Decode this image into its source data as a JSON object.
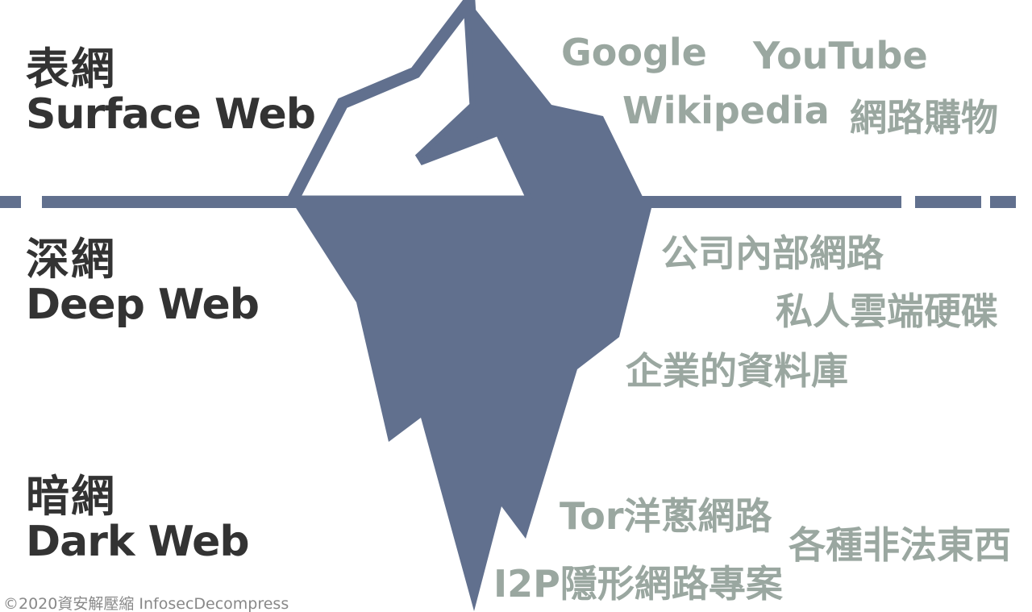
{
  "layers": [
    {
      "zh": "表網",
      "en": "Surface Web"
    },
    {
      "zh": "深網",
      "en": "Deep Web"
    },
    {
      "zh": "暗網",
      "en": "Dark Web"
    }
  ],
  "surface_examples": [
    "Google",
    "YouTube",
    "Wikipedia",
    "網路購物"
  ],
  "deep_examples": [
    "公司內部網路",
    "私人雲端硬碟",
    "企業的資料庫"
  ],
  "dark_examples": [
    "Tor洋蔥網路",
    "各種非法東西",
    "I2P隱形網路專案"
  ],
  "credit": "©2020資安解壓縮 InfosecDecompress",
  "colors": {
    "iceberg": "#61708e",
    "label": "#333333",
    "example": "#9aa7a0"
  }
}
